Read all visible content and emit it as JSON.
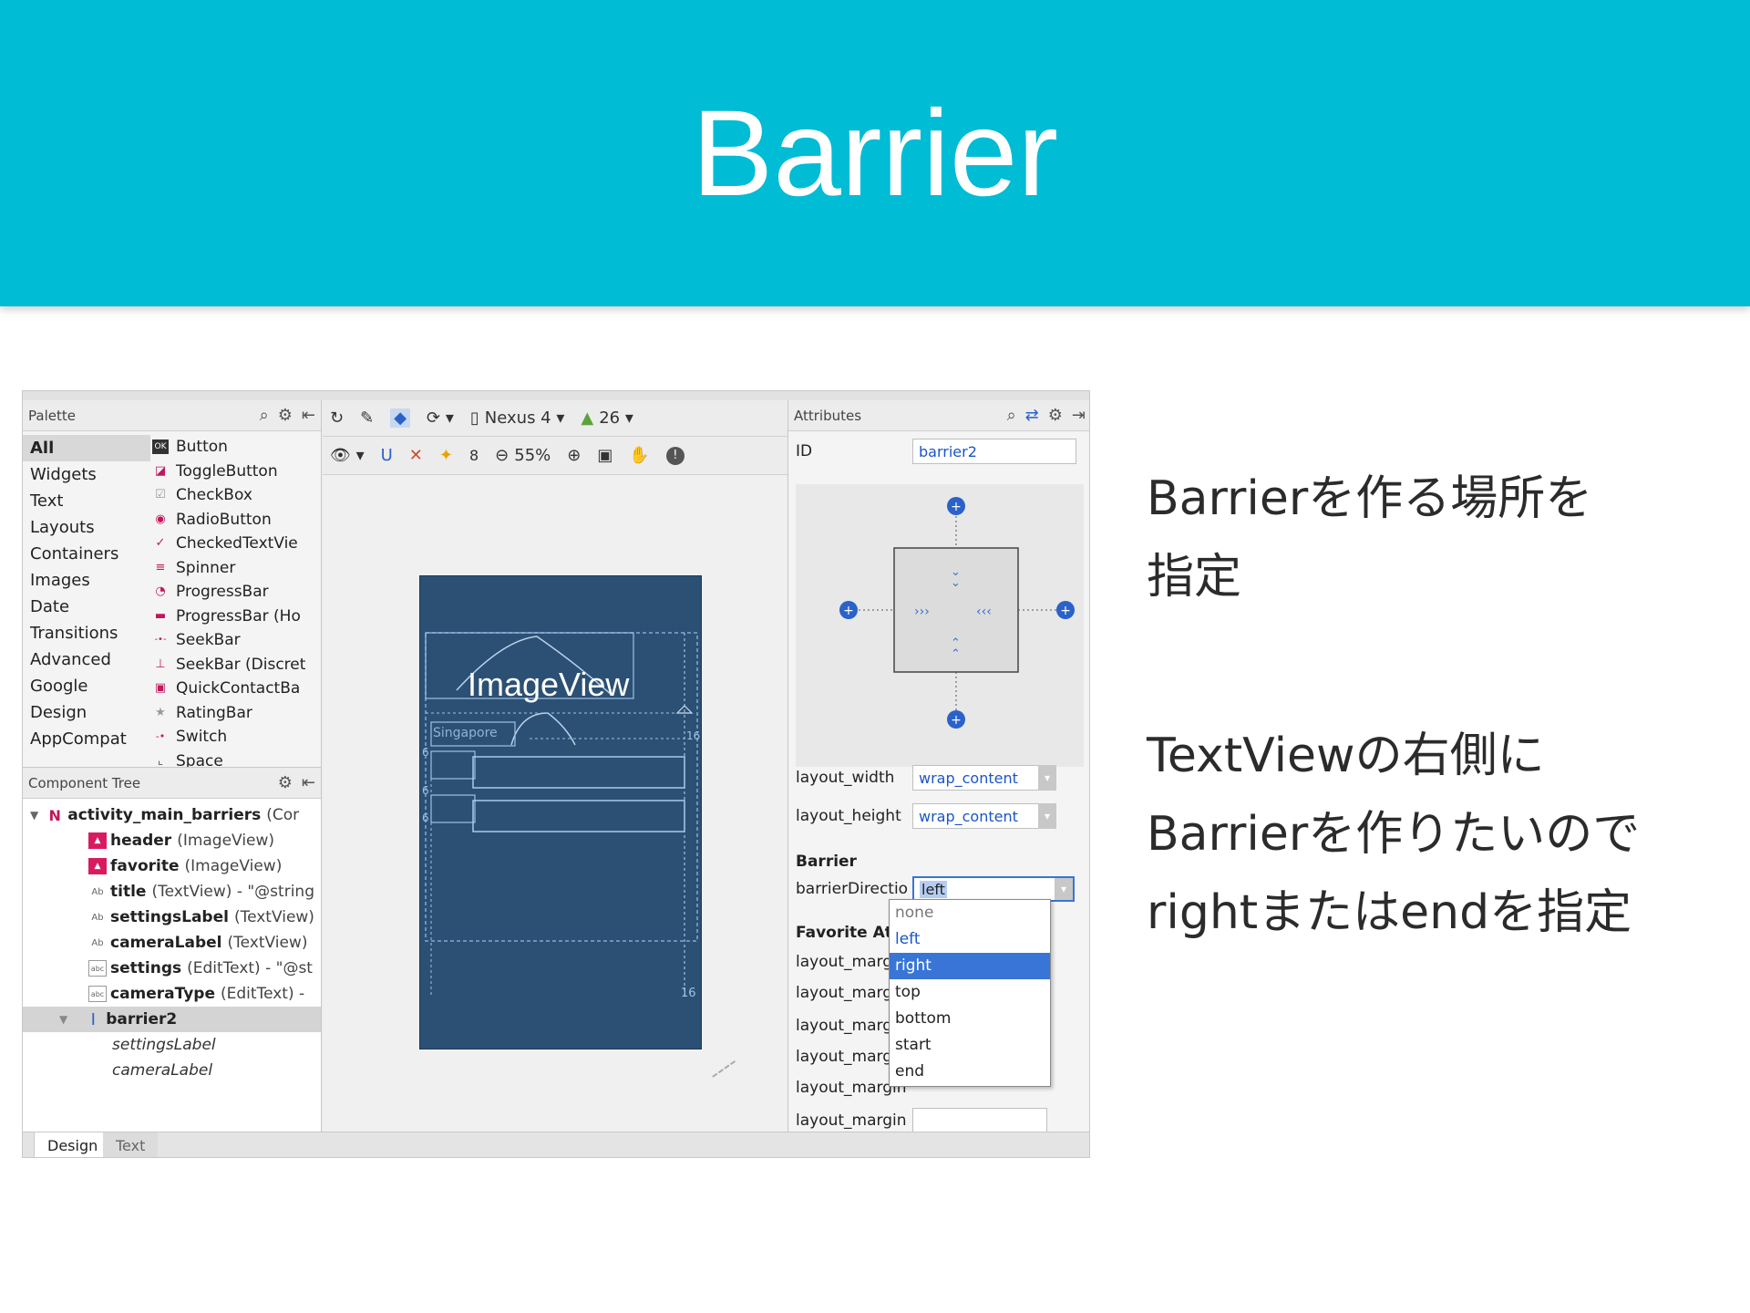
{
  "slide": {
    "title": "Barrier",
    "description_1": [
      "Barrierを作る場所を",
      "指定"
    ],
    "description_2": [
      "TextViewの右側に",
      "Barrierを作りたいので",
      "rightまたはendを指定"
    ]
  },
  "colors": {
    "header": "#00BCD4",
    "selection": "#3875d7",
    "blueprint": "#2c5074"
  },
  "palette": {
    "header": "Palette",
    "categories": [
      "All",
      "Widgets",
      "Text",
      "Layouts",
      "Containers",
      "Images",
      "Date",
      "Transitions",
      "Advanced",
      "Google",
      "Design",
      "AppCompat"
    ],
    "items": [
      {
        "icon": "ok-button-icon",
        "label": "Button"
      },
      {
        "icon": "toggle-button-icon",
        "label": "ToggleButton"
      },
      {
        "icon": "checkbox-icon",
        "label": "CheckBox"
      },
      {
        "icon": "radio-button-icon",
        "label": "RadioButton"
      },
      {
        "icon": "checked-textview-icon",
        "label": "CheckedTextVie"
      },
      {
        "icon": "spinner-icon",
        "label": "Spinner"
      },
      {
        "icon": "progressbar-icon",
        "label": "ProgressBar"
      },
      {
        "icon": "progressbar-horizontal-icon",
        "label": "ProgressBar (Ho"
      },
      {
        "icon": "seekbar-icon",
        "label": "SeekBar"
      },
      {
        "icon": "seekbar-discrete-icon",
        "label": "SeekBar (Discret"
      },
      {
        "icon": "quick-contact-badge-icon",
        "label": "QuickContactBa"
      },
      {
        "icon": "ratingbar-icon",
        "label": "RatingBar"
      },
      {
        "icon": "switch-icon",
        "label": "Switch"
      },
      {
        "icon": "space-icon",
        "label": "Space"
      }
    ]
  },
  "tree": {
    "header": "Component Tree",
    "root": {
      "name": "activity_main_barriers",
      "type": "(Cor"
    },
    "rows": [
      {
        "icon": "image-icon",
        "name": "header",
        "type": "(ImageView)"
      },
      {
        "icon": "image-icon",
        "name": "favorite",
        "type": "(ImageView)"
      },
      {
        "icon": "text-icon",
        "name": "title",
        "type": "(TextView) - \"@string"
      },
      {
        "icon": "text-icon",
        "name": "settingsLabel",
        "type": "(TextView)"
      },
      {
        "icon": "text-icon",
        "name": "cameraLabel",
        "type": "(TextView)"
      },
      {
        "icon": "edittext-icon",
        "name": "settings",
        "type": "(EditText) - \"@st"
      },
      {
        "icon": "edittext-icon",
        "name": "cameraType",
        "type": "(EditText) -"
      }
    ],
    "barrier": "barrier2",
    "refs": [
      "settingsLabel",
      "cameraLabel"
    ]
  },
  "toolbar": {
    "device": "Nexus 4",
    "api": "26",
    "margin": "8",
    "zoom": "55%"
  },
  "canvas": {
    "image_label": "ImageView",
    "tag_label": "Singapore",
    "dim_a": "16",
    "dim_b": "16",
    "dim_c": "6",
    "dim_d": "6",
    "dim_e": "6"
  },
  "attributes": {
    "header": "Attributes",
    "id_label": "ID",
    "id_value": "barrier2",
    "layout_width_label": "layout_width",
    "layout_width_value": "wrap_content",
    "layout_height_label": "layout_height",
    "layout_height_value": "wrap_content",
    "section_barrier": "Barrier",
    "barrier_direction_label": "barrierDirection",
    "barrier_direction_value": "left",
    "section_favorite": "Favorite Attributes",
    "margin_label": "layout_margin",
    "dropdown_options": [
      "none",
      "left",
      "right",
      "top",
      "bottom",
      "start",
      "end"
    ],
    "dropdown_selected": "right"
  },
  "tabs": {
    "design": "Design",
    "text": "Text"
  }
}
